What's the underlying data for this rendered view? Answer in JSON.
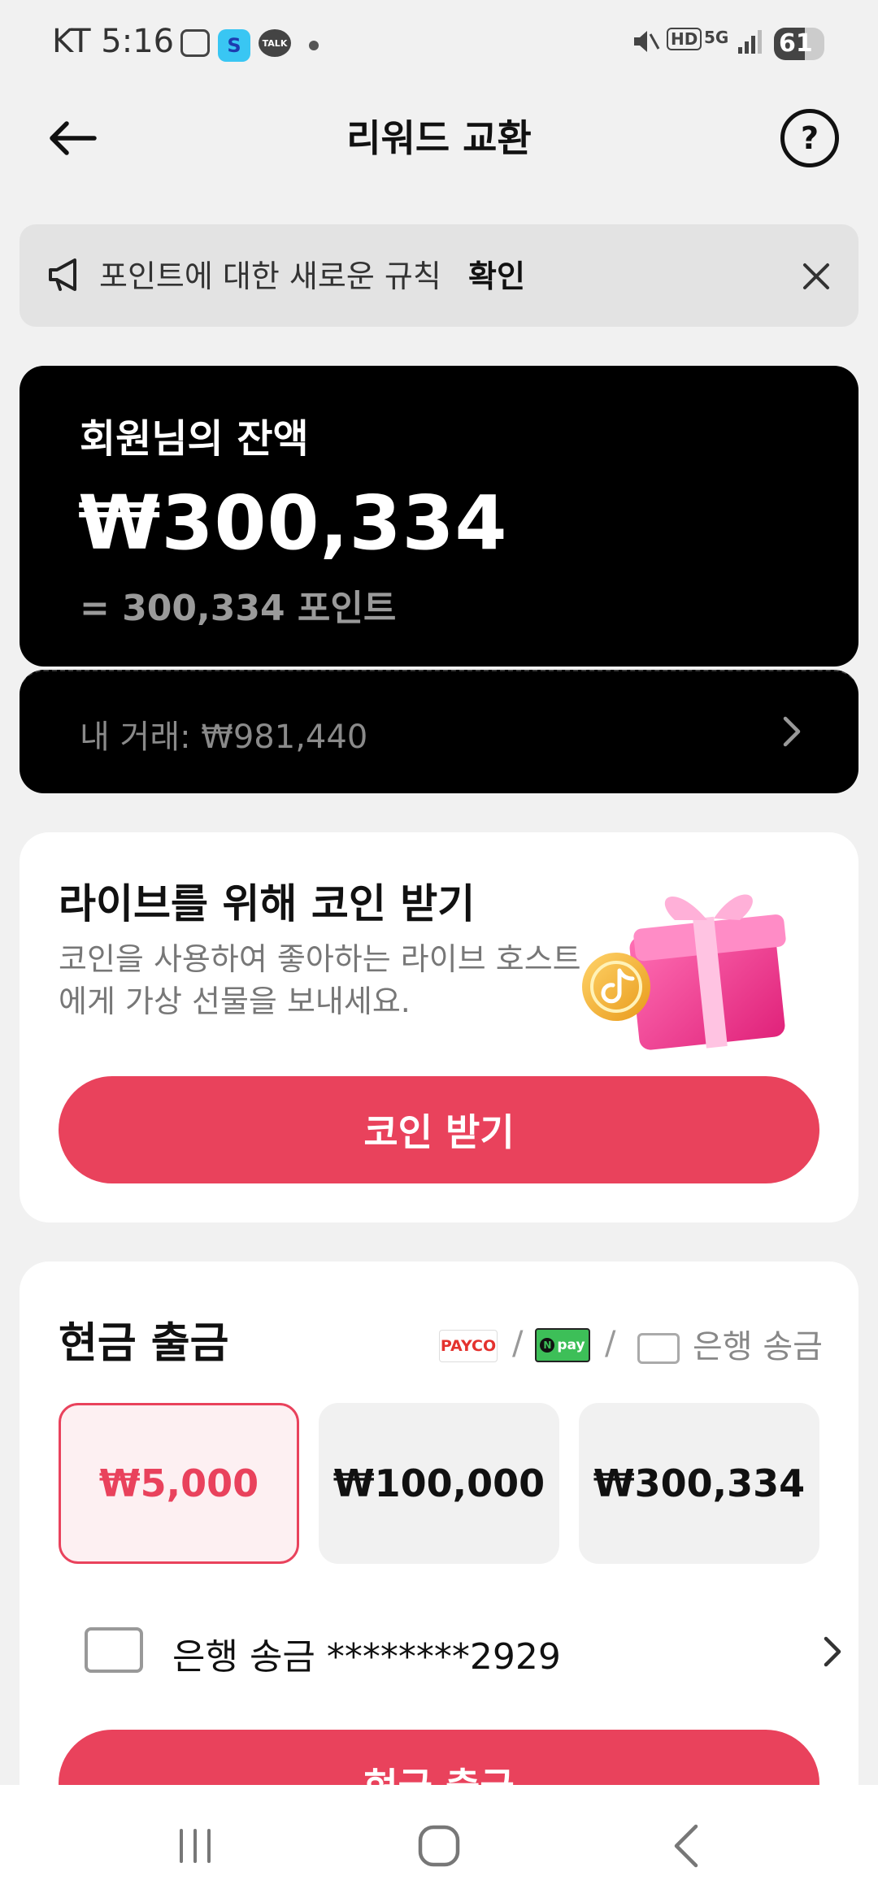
{
  "status_bar": {
    "time": "KT 5:16",
    "network": "HD",
    "signal": "5G",
    "battery": "61",
    "battery_fraction": 0.61,
    "talk_label": "TALK"
  },
  "header": {
    "title": "리워드 교환",
    "back_icon": "arrow-left-icon",
    "help_icon": "question-circle-icon",
    "help_glyph": "?"
  },
  "notice": {
    "text": "포인트에 대한 새로운 규칙",
    "link": "확인",
    "icon": "megaphone-icon",
    "close_icon": "close-icon"
  },
  "balance": {
    "label": "회원님의 잔액",
    "amount": "₩300,334",
    "points": "= 300,334 포인트",
    "transactions": "내 거래: ₩981,440"
  },
  "coins": {
    "title": "라이브를 위해 코인 받기",
    "description": "코인을 사용하여 좋아하는 라이브 호스트에게 가상 선물을 보내세요.",
    "button": "코인 받기",
    "illustration": "gift-box-coin-icon"
  },
  "withdraw": {
    "title": "현금 출금",
    "methods": {
      "payco": "PAYCO",
      "npay": "pay",
      "npay_n": "N",
      "separator": "/",
      "bank": "은행 송금"
    },
    "amounts": [
      "₩5,000",
      "₩100,000",
      "₩300,334"
    ],
    "selected_index": 0,
    "bank_account": "은행 송금 ********2929",
    "button": "현금 출금"
  },
  "colors": {
    "accent": "#e9425c",
    "card_dark": "#000000",
    "background": "#f1f1f1"
  }
}
